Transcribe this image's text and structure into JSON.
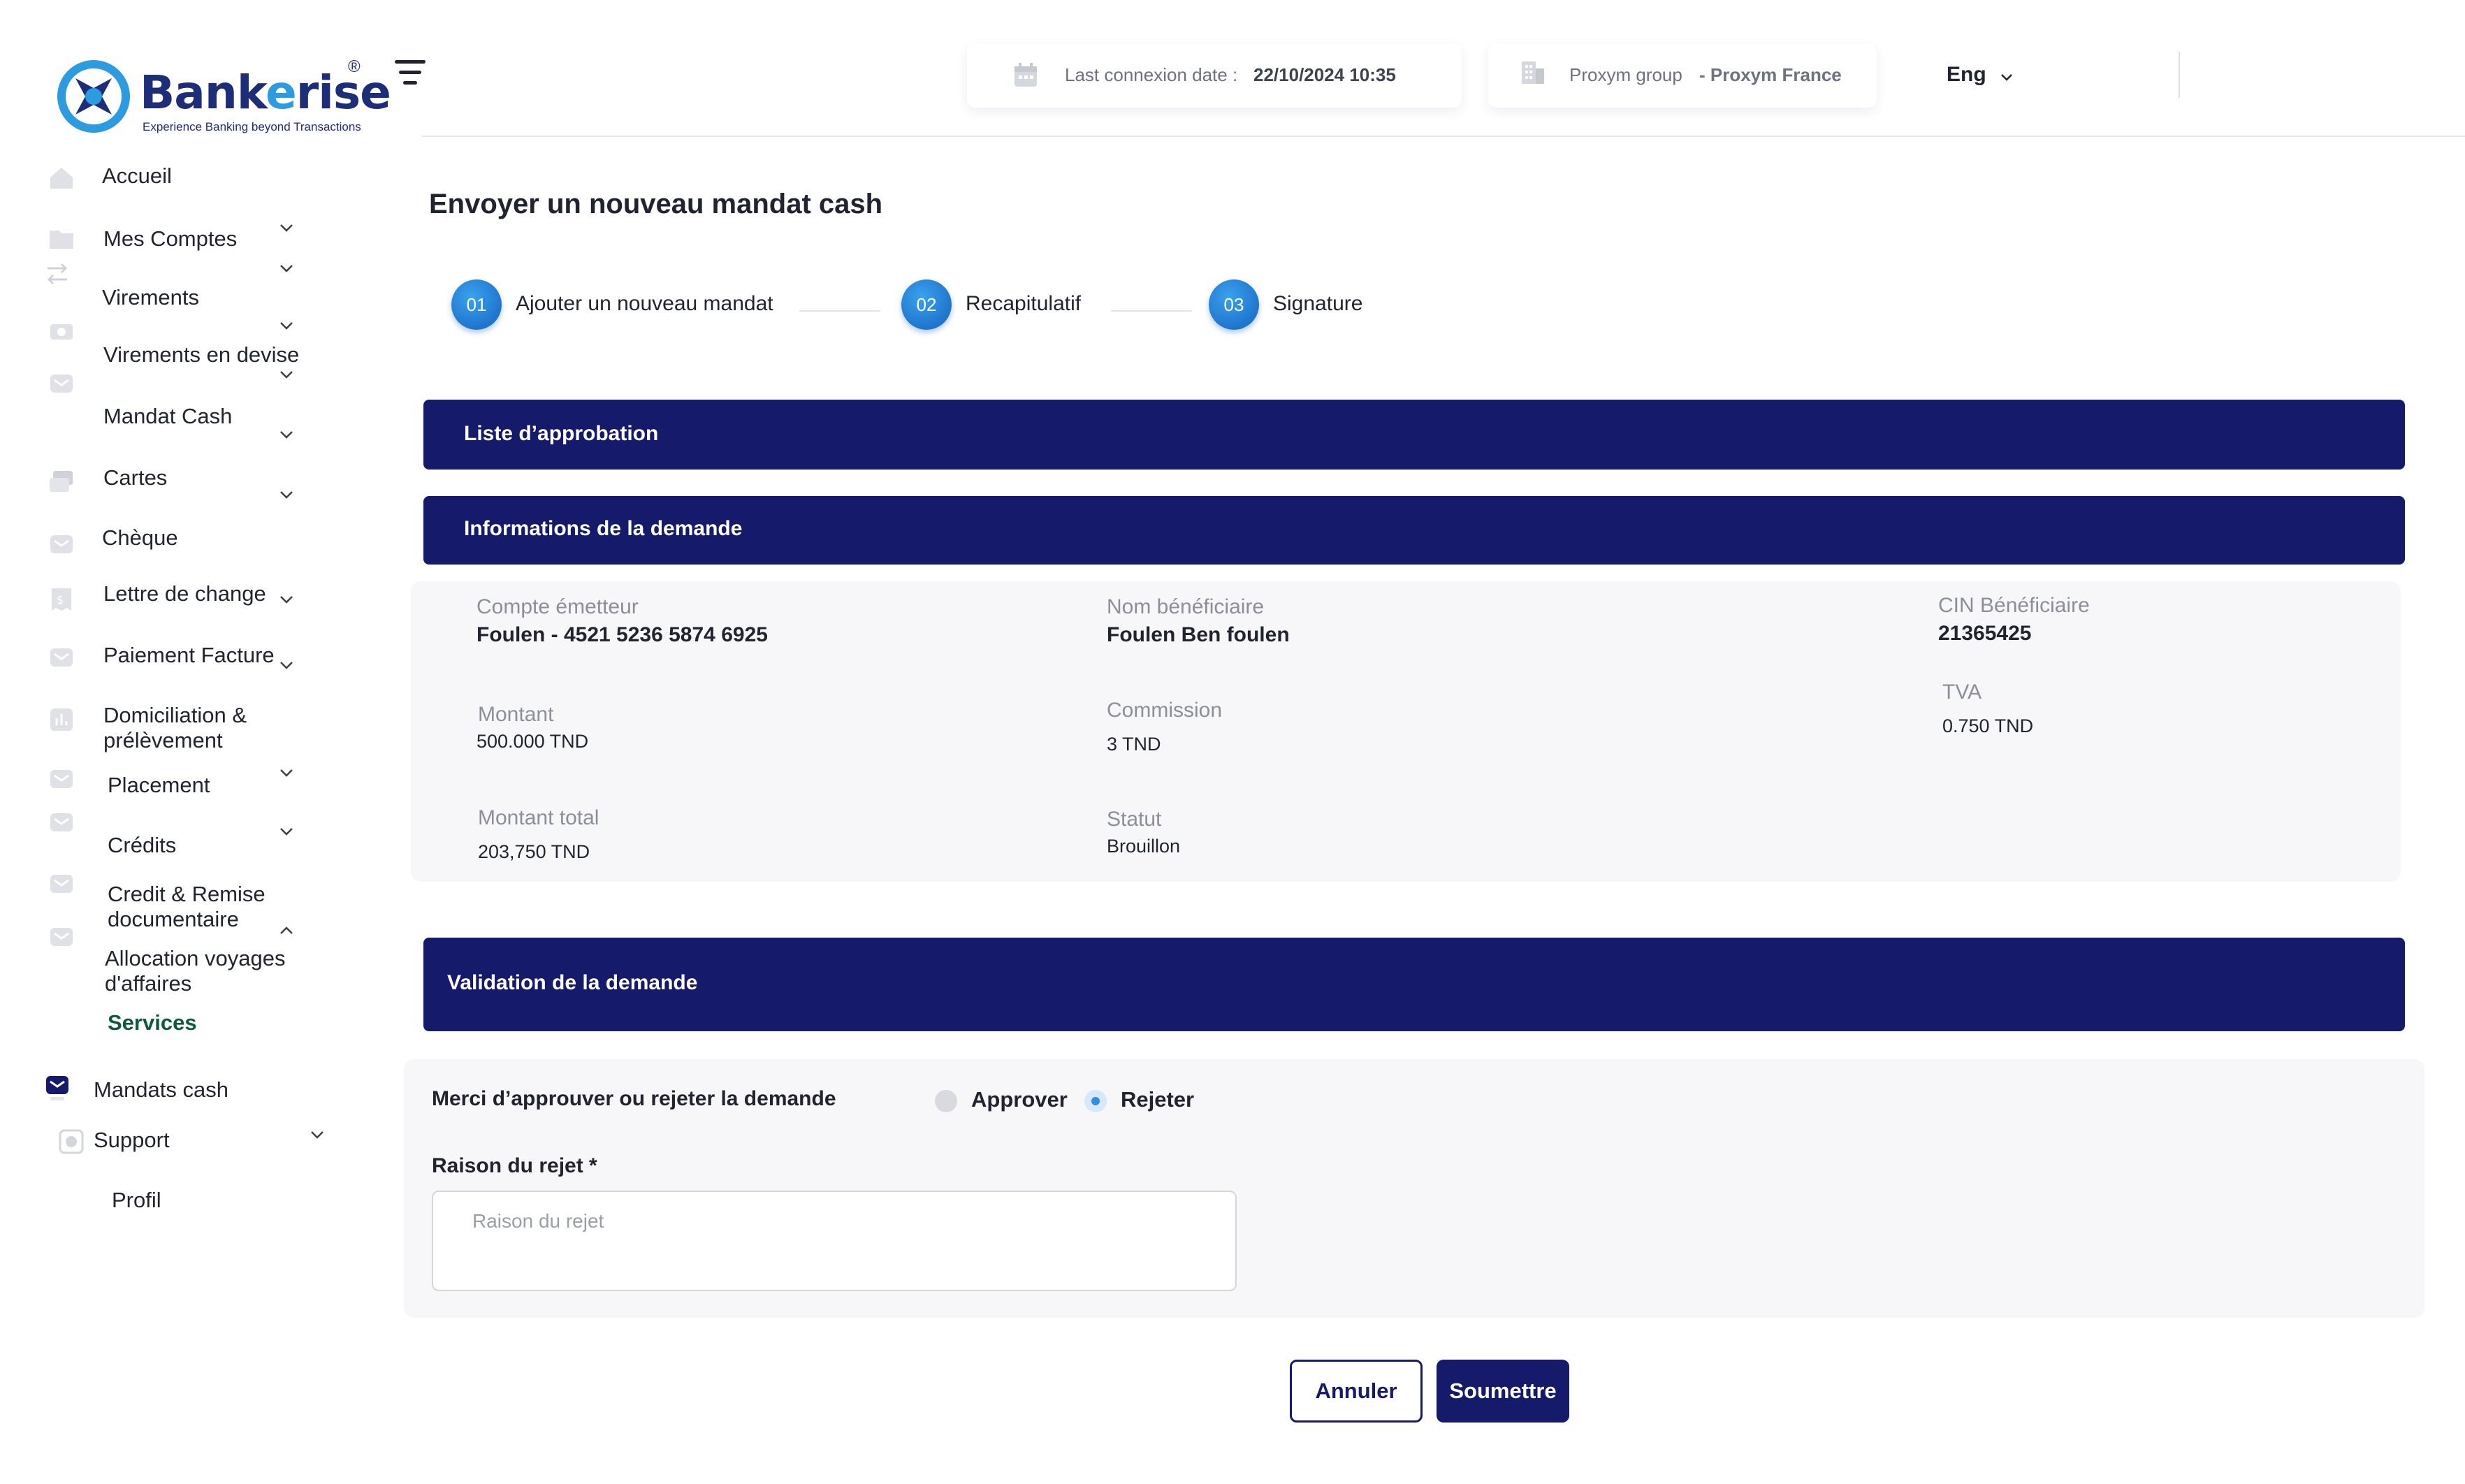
{
  "brand": {
    "name_start": "Bank",
    "name_accent": "e",
    "name_end": "rise",
    "registered": "®",
    "tagline": "Experience Banking beyond Transactions"
  },
  "topbar": {
    "last_connexion_label": "Last connexion date :",
    "last_connexion_value": "22/10/2024 10:35",
    "group_label": "Proxym group",
    "group_value": "- Proxym France",
    "language": "Eng"
  },
  "sidebar": {
    "items": [
      {
        "label": "Accueil",
        "icon": "home-icon"
      },
      {
        "label": "Mes Comptes",
        "icon": "folder-icon"
      },
      {
        "label": "Virements",
        "icon": "transfer-icon"
      },
      {
        "label": "Virements en devise",
        "icon": "currency-icon"
      },
      {
        "label": "Mandat Cash",
        "icon": "mail-icon"
      },
      {
        "label": "Cartes",
        "icon": "cards-icon"
      },
      {
        "label": "Chèque",
        "icon": "mail-icon"
      },
      {
        "label": "Lettre de change",
        "icon": "bill-icon"
      },
      {
        "label": "Paiement Facture",
        "icon": "mail-icon"
      },
      {
        "label": "Domiciliation &",
        "label2": "prélèvement",
        "icon": "chart-icon"
      },
      {
        "label": "Placement",
        "icon": "mail-icon"
      },
      {
        "label": "Crédits",
        "icon": "mail-icon"
      },
      {
        "label": "Credit & Remise",
        "label2": "documentaire",
        "icon": "mail-icon"
      },
      {
        "label": "Allocation  voyages",
        "label2": "d'affaires",
        "icon": "mail-icon"
      },
      {
        "label": "Services"
      },
      {
        "label": "Mandats cash",
        "icon": "mail-icon"
      },
      {
        "label": "Support",
        "icon": "support-icon"
      },
      {
        "label": "Profil"
      }
    ]
  },
  "page": {
    "title": "Envoyer un nouveau mandat cash",
    "steps": [
      {
        "num": "01",
        "label": "Ajouter un nouveau mandat"
      },
      {
        "num": "02",
        "label": "Recapitulatif"
      },
      {
        "num": "03",
        "label": "Signature"
      }
    ]
  },
  "sections": {
    "approval_list": "Liste d’approbation",
    "request_info": "Informations de la demande",
    "validation": "Validation de la demande"
  },
  "request": {
    "compte_emetteur_label": "Compte émetteur",
    "compte_emetteur_value": "Foulen - 4521 5236 5874 6925",
    "nom_beneficiaire_label": "Nom bénéficiaire",
    "nom_beneficiaire_value": "Foulen Ben foulen",
    "cin_label": "CIN Bénéficiaire",
    "cin_value": "21365425",
    "montant_label": "Montant",
    "montant_value": "500.000 TND",
    "commission_label": "Commission",
    "commission_value": "3 TND",
    "tva_label": "TVA",
    "tva_value": "0.750 TND",
    "montant_total_label": "Montant total",
    "montant_total_value": "203,750  TND",
    "statut_label": "Statut",
    "statut_value": "Brouillon"
  },
  "validation": {
    "question": "Merci d’approuver ou rejeter la demande",
    "approve_label": "Approver",
    "reject_label": "Rejeter",
    "selected": "Rejeter",
    "reason_label": "Raison du rejet *",
    "reason_placeholder": "Raison du rejet",
    "reason_value": ""
  },
  "actions": {
    "cancel": "Annuler",
    "submit": "Soumettre"
  },
  "colors": {
    "navy": "#151a6b",
    "step_blue": "#2478d2",
    "accent_green": "#0f5a3a",
    "panel_bg": "#f7f7f9"
  }
}
